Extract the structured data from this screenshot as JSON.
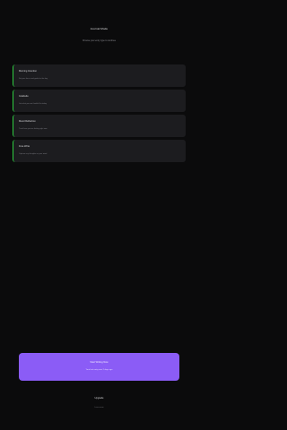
{
  "header": {
    "title": "Journal Mode",
    "subtitle": "Choose your entry type to continue"
  },
  "entries": [
    {
      "title": "Morning Intention",
      "subtitle": "Set your focus and goals for the day"
    },
    {
      "title": "Gratitude",
      "subtitle": "List what you are thankful for today"
    },
    {
      "title": "Mood Reflection",
      "subtitle": "Track how you are feeling right now"
    },
    {
      "title": "Free Write",
      "subtitle": "Capture any thoughts on your mind"
    }
  ],
  "cta": {
    "label": "Start Writing Now",
    "sublabel": "Your last entry was 2 days ago"
  },
  "footer": {
    "title": "Upgrade",
    "link": "Learn more"
  },
  "colors": {
    "background": "#0b0b0c",
    "card": "#1c1c1f",
    "accent_bar": "#2ecc40",
    "cta": "#8b5cf6"
  }
}
